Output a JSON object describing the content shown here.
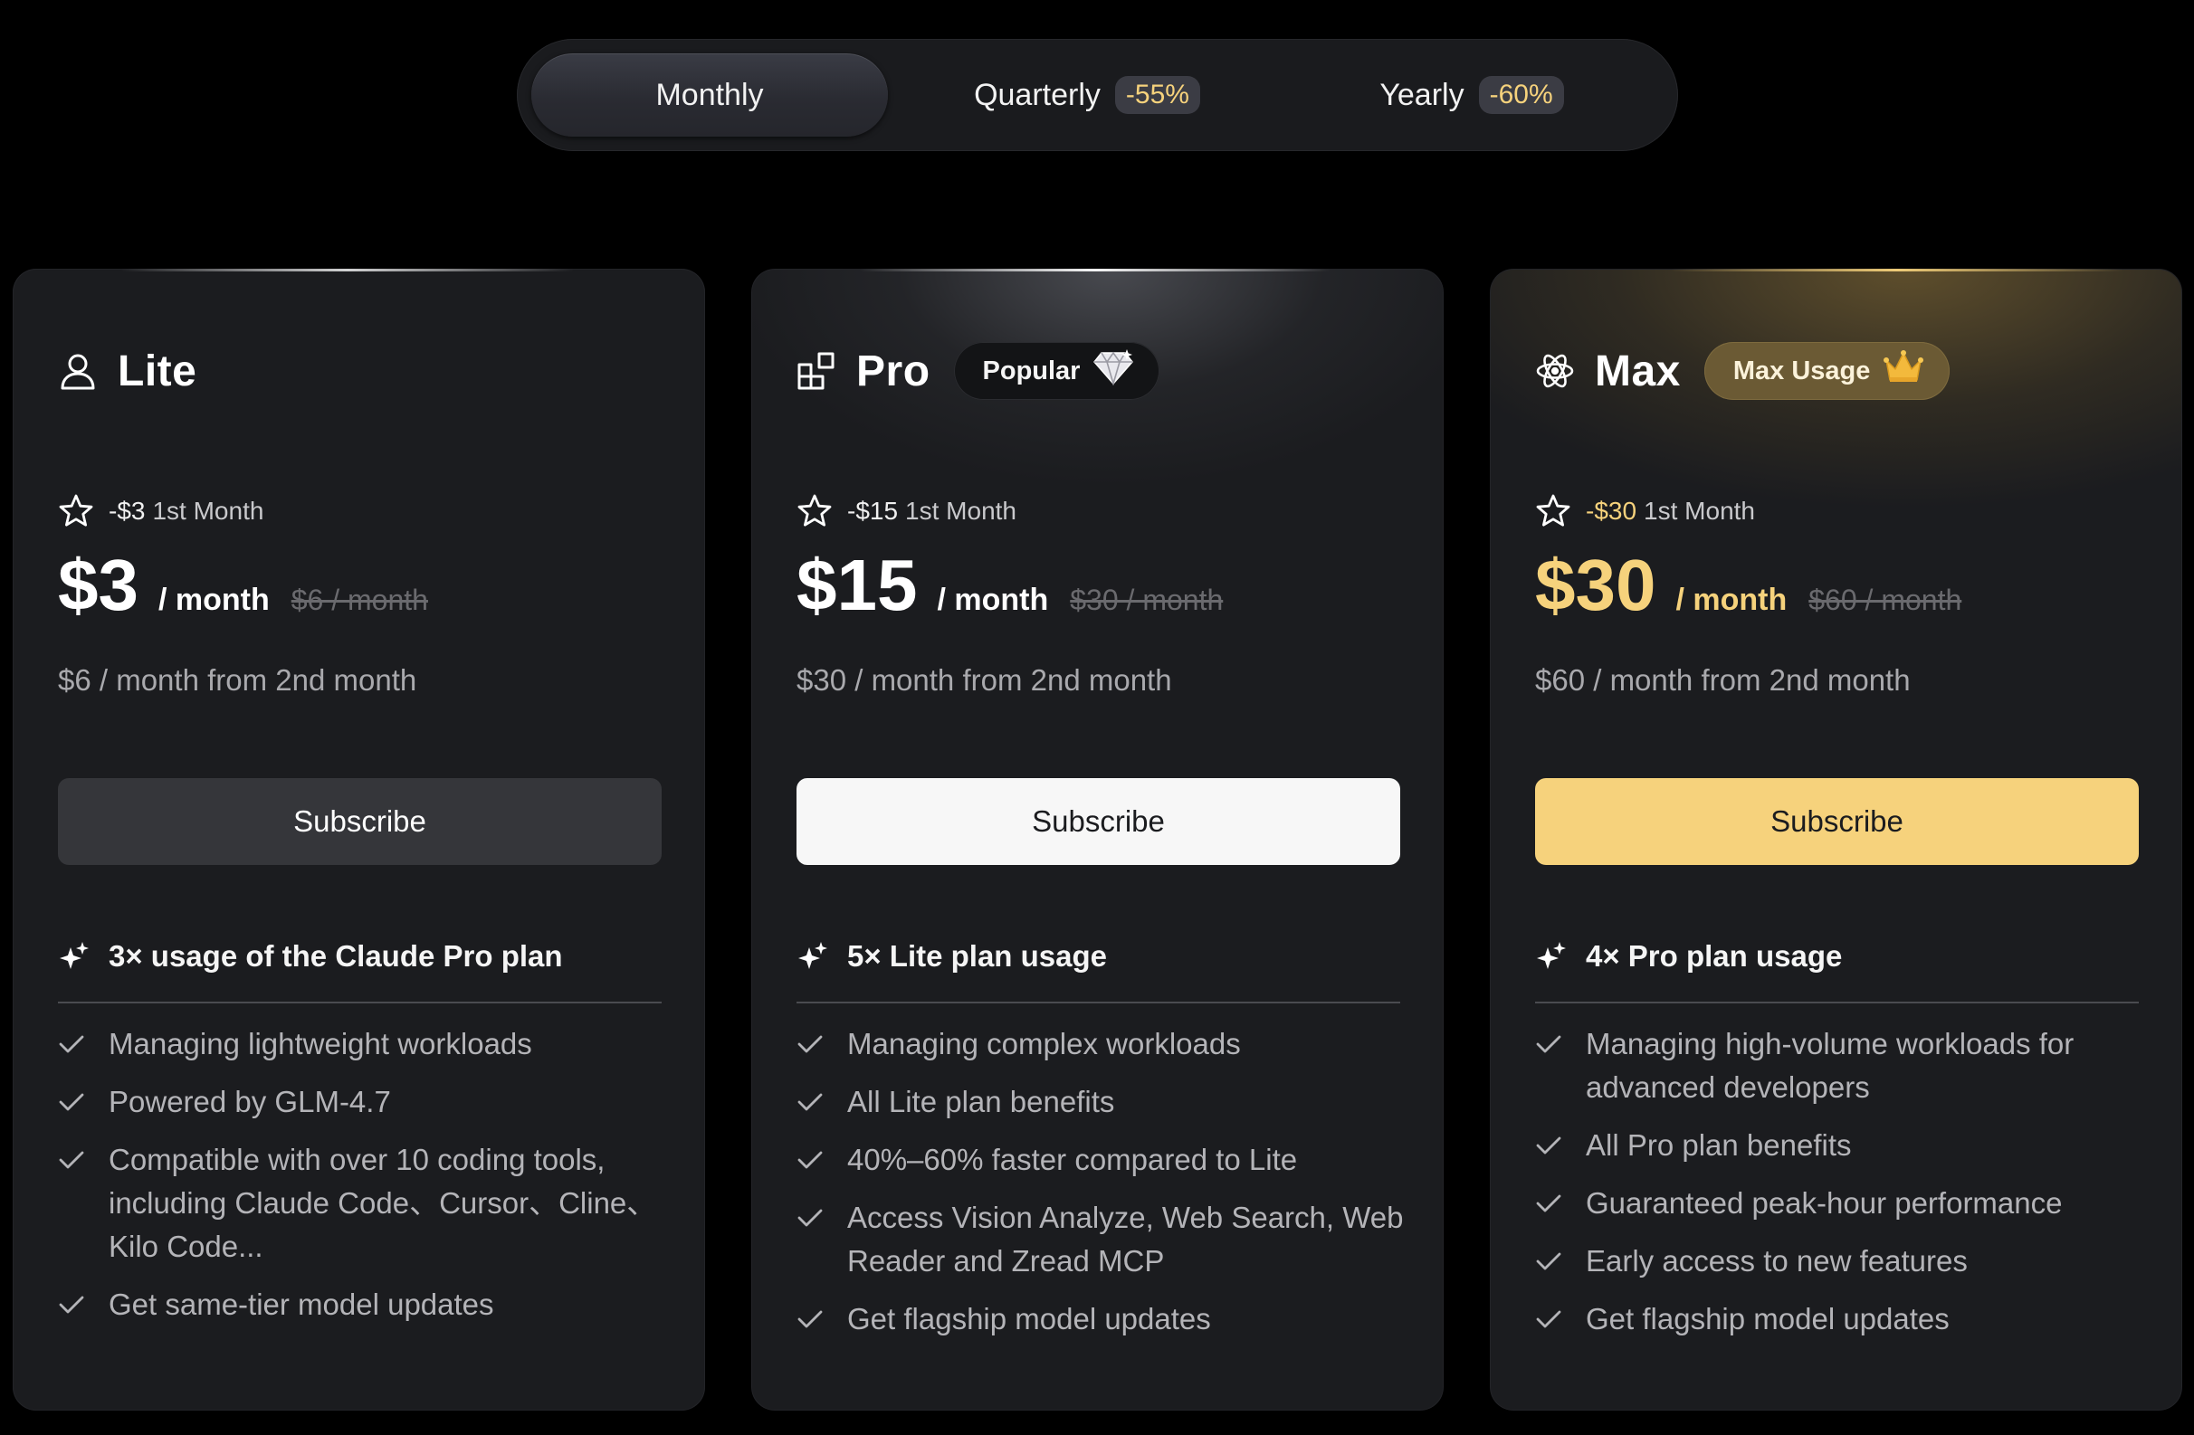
{
  "billing": {
    "options": [
      {
        "label": "Monthly",
        "discount": null
      },
      {
        "label": "Quarterly",
        "discount": "-55%"
      },
      {
        "label": "Yearly",
        "discount": "-60%"
      }
    ]
  },
  "plans": [
    {
      "name": "Lite",
      "icon": "user-icon",
      "badge": null,
      "promo_amount": "-$3",
      "promo_label": "1st Month",
      "price": "$3",
      "per": "/ month",
      "old_price": "$6 / month",
      "after_price": "$6 / month from 2nd month",
      "cta": "Subscribe",
      "highlight": "3× usage of the Claude Pro plan",
      "features": [
        "Managing lightweight workloads",
        "Powered by GLM-4.7",
        "Compatible with over 10 coding tools, including Claude Code、Cursor、Cline、Kilo Code...",
        "Get same-tier model updates"
      ]
    },
    {
      "name": "Pro",
      "icon": "blocks-icon",
      "badge": "Popular",
      "badge_icon": "diamond-icon",
      "promo_amount": "-$15",
      "promo_label": "1st Month",
      "price": "$15",
      "per": "/ month",
      "old_price": "$30 / month",
      "after_price": "$30 / month from 2nd month",
      "cta": "Subscribe",
      "highlight": "5× Lite plan usage",
      "features": [
        "Managing complex workloads",
        "All Lite plan benefits",
        "40%–60% faster compared to Lite",
        "Access Vision Analyze, Web Search, Web Reader and Zread MCP",
        "Get flagship model updates"
      ]
    },
    {
      "name": "Max",
      "icon": "atom-icon",
      "badge": "Max Usage",
      "badge_icon": "crown-icon",
      "promo_amount": "-$30",
      "promo_label": "1st Month",
      "price": "$30",
      "per": "/ month",
      "old_price": "$60 / month",
      "after_price": "$60 / month from 2nd month",
      "cta": "Subscribe",
      "highlight": "4× Pro plan usage",
      "features": [
        "Managing high-volume workloads for advanced developers",
        "All Pro plan benefits",
        "Guaranteed peak-hour performance",
        "Early access to new features",
        "Get flagship model updates"
      ]
    }
  ],
  "colors": {
    "background": "#000000",
    "card": "#1b1c1f",
    "accent_gold": "#f6d27c",
    "muted_text": "#b4b4b8"
  }
}
